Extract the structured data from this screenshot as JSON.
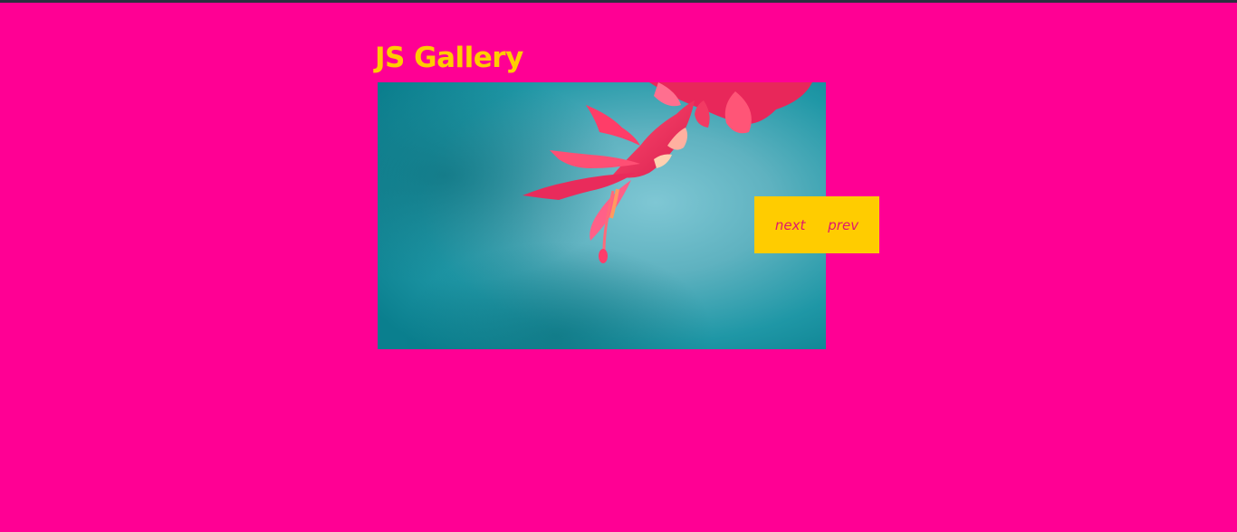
{
  "colors": {
    "background": "#ff0094",
    "accent": "#ffcc00",
    "control_text": "#e0196d"
  },
  "header": {
    "title": "JS Gallery"
  },
  "gallery": {
    "image_description": "red cactus flower on teal background"
  },
  "controls": {
    "next_label": "next",
    "prev_label": "prev"
  }
}
